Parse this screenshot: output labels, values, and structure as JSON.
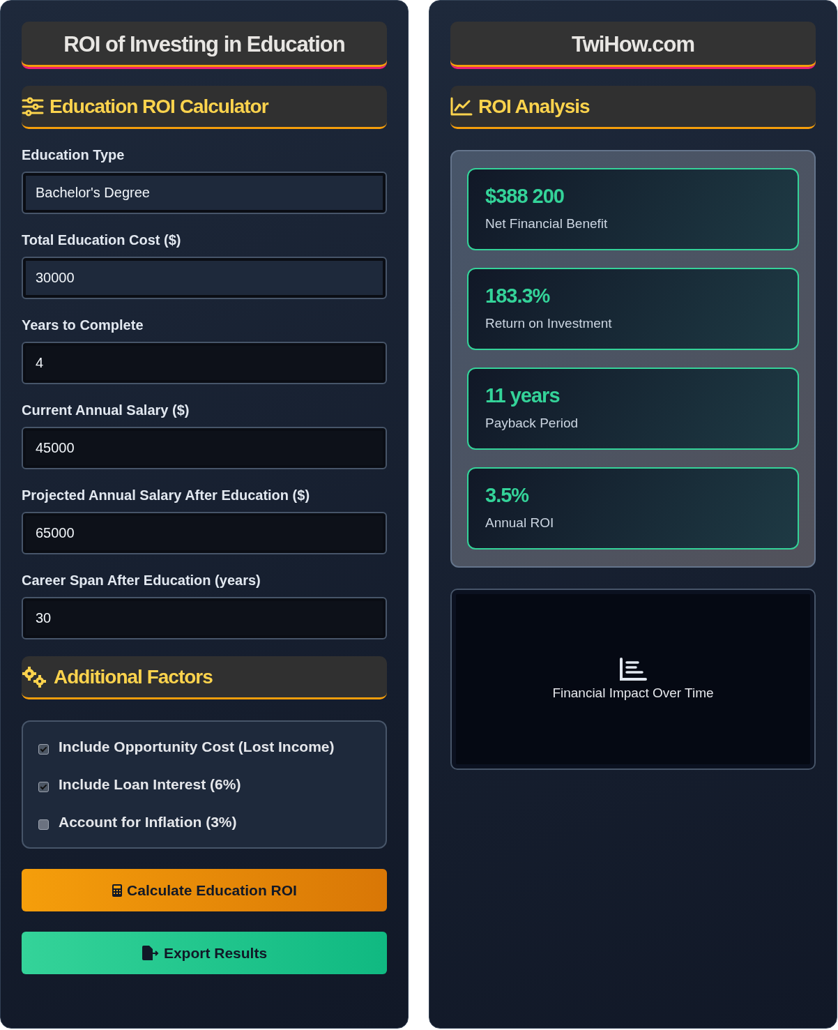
{
  "left_panel": {
    "title": "ROI of Investing in Education",
    "calculator_heading": {
      "text": "Education ROI Calculator"
    },
    "fields": [
      {
        "label": "Education Type",
        "value": "Bachelor's Degree",
        "highlighted": true
      },
      {
        "label": "Total Education Cost ($)",
        "value": "30000",
        "highlighted": true
      },
      {
        "label": "Years to Complete",
        "value": "4",
        "highlighted": false
      },
      {
        "label": "Current Annual Salary ($)",
        "value": "45000",
        "highlighted": false
      },
      {
        "label": "Projected Annual Salary After Education ($)",
        "value": "65000",
        "highlighted": false
      },
      {
        "label": "Career Span After Education (years)",
        "value": "30",
        "highlighted": false
      }
    ],
    "factors_heading": {
      "text": "Additional Factors"
    },
    "factors": [
      {
        "label": "Include Opportunity Cost (Lost Income)",
        "checked": true
      },
      {
        "label": "Include Loan Interest (6%)",
        "checked": true
      },
      {
        "label": "Account for Inflation (3%)",
        "checked": false
      }
    ],
    "buttons": [
      {
        "label": "Calculate Education ROI",
        "kind": "calculate"
      },
      {
        "label": "Export Results",
        "kind": "export"
      }
    ]
  },
  "right_panel": {
    "title": "TwiHow.com",
    "analysis_heading": {
      "text": "ROI Analysis"
    },
    "results": [
      {
        "value": "$388 200",
        "label": "Net Financial Benefit"
      },
      {
        "value": "183.3%",
        "label": "Return on Investment"
      },
      {
        "value": "11 years",
        "label": "Payback Period"
      },
      {
        "value": "3.5%",
        "label": "Annual ROI"
      }
    ],
    "chart_placeholder": {
      "text": "Financial Impact Over Time"
    }
  }
}
